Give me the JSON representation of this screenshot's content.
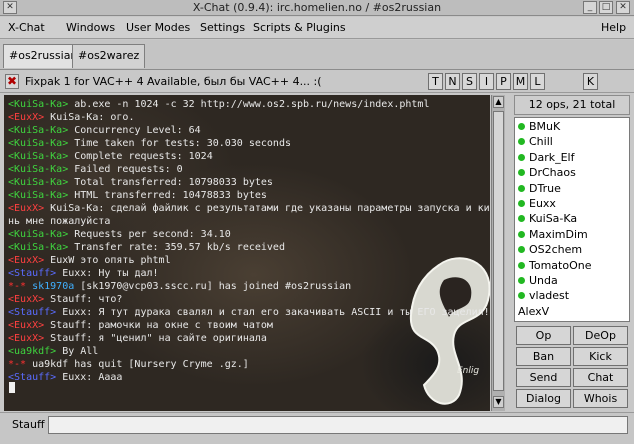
{
  "window": {
    "title": "X-Chat (0.9.4): irc.homelien.no / #os2russian",
    "btn_close": "✕",
    "btn_min": "_",
    "btn_max": "□"
  },
  "menu": [
    "X-Chat",
    "Windows",
    "User Modes",
    "Settings",
    "Scripts & Plugins",
    "Help"
  ],
  "tabs": [
    {
      "label": "#os2russian",
      "active": true
    },
    {
      "label": "#os2warez",
      "active": false
    }
  ],
  "topic": {
    "close_glyph": "✖",
    "text": "Fixpak 1 for VAC++ 4 Available, был бы VAC++ 4... :(",
    "modes": [
      "T",
      "N",
      "S",
      "I",
      "P",
      "M",
      "L"
    ],
    "key_mode": "K"
  },
  "chat": {
    "lines": [
      {
        "nick": "KuiSa-Ka",
        "nick_color": "green",
        "text": " ab.exe -n 1024 -c 32 http://www.os2.spb.ru/news/index.phtml"
      },
      {
        "nick": "EuxX",
        "nick_color": "red",
        "text": " KuiSa-Ka: ого."
      },
      {
        "nick": "KuiSa-Ka",
        "nick_color": "green",
        "text": " Concurrency Level:      64"
      },
      {
        "nick": "KuiSa-Ka",
        "nick_color": "green",
        "text": " Time taken for tests:   30.030 seconds"
      },
      {
        "nick": "KuiSa-Ka",
        "nick_color": "green",
        "text": " Complete requests:      1024"
      },
      {
        "nick": "KuiSa-Ka",
        "nick_color": "green",
        "text": " Failed requests:        0"
      },
      {
        "nick": "KuiSa-Ka",
        "nick_color": "green",
        "text": " Total transferred:      10798033 bytes"
      },
      {
        "nick": "KuiSa-Ka",
        "nick_color": "green",
        "text": " HTML transferred:       10478833 bytes"
      },
      {
        "nick": "EuxX",
        "nick_color": "red",
        "text": " KuiSa-Ka: сделай файлик с результатами где указаны параметры запуска и ки"
      },
      {
        "nick": "",
        "nick_color": "none",
        "text": "нь мне пожалуйста"
      },
      {
        "nick": "KuiSa-Ka",
        "nick_color": "green",
        "text": " Requests per second:    34.10"
      },
      {
        "nick": "KuiSa-Ka",
        "nick_color": "green",
        "text": " Transfer rate:          359.57 kb/s received"
      },
      {
        "nick": "EuxX",
        "nick_color": "red",
        "text": " EuxW это опять phtml"
      },
      {
        "nick": "Stauff",
        "nick_color": "blue",
        "text": " Euxx: Ну ты дал!"
      },
      {
        "nick": "sk1970a",
        "nick_color": "join",
        "stars": "*-*",
        "text": " [sk1970@vcp03.sscc.ru] has joined #os2russian"
      },
      {
        "nick": "EuxX",
        "nick_color": "red",
        "text": " Stauff: что?"
      },
      {
        "nick": "Stauff",
        "nick_color": "blue",
        "text": " Euxx: Я тут дурака свалял и стал его закачивать ASCII и ты ЕГО зацелил!"
      },
      {
        "nick": "EuxX",
        "nick_color": "red",
        "text": " Stauff: рамочки на окне с твоим чатом"
      },
      {
        "nick": "EuxX",
        "nick_color": "red",
        "text": " Stauff: я \"ценил\" на сайте оригинала"
      },
      {
        "nick": "ua9kdf",
        "nick_color": "green",
        "text": " By All"
      },
      {
        "nick": "",
        "nick_color": "quit",
        "stars": "*-*",
        "text": " ua9kdf has quit [Nursery Cryme .gz.]"
      },
      {
        "nick": "Stauff",
        "nick_color": "blue",
        "text": " Euxx: Аааа"
      }
    ],
    "logo_text": "Enlig"
  },
  "ops_count": "12 ops, 21 total",
  "users": [
    {
      "name": "BMuK",
      "op": true
    },
    {
      "name": "Chill",
      "op": true
    },
    {
      "name": "Dark_Elf",
      "op": true
    },
    {
      "name": "DrChaos",
      "op": true
    },
    {
      "name": "DTrue",
      "op": true
    },
    {
      "name": "Euxx",
      "op": true
    },
    {
      "name": "KuiSa-Ka",
      "op": true
    },
    {
      "name": "MaximDim",
      "op": true
    },
    {
      "name": "OS2chem",
      "op": true
    },
    {
      "name": "TomatoOne",
      "op": true
    },
    {
      "name": "Unda",
      "op": true
    },
    {
      "name": "vladest",
      "op": true
    },
    {
      "name": "AlexV",
      "op": false
    }
  ],
  "user_buttons": [
    "Op",
    "DeOp",
    "Ban",
    "Kick",
    "Send",
    "Chat",
    "Dialog",
    "Whois"
  ],
  "input": {
    "nick": "Stauff",
    "value": ""
  }
}
